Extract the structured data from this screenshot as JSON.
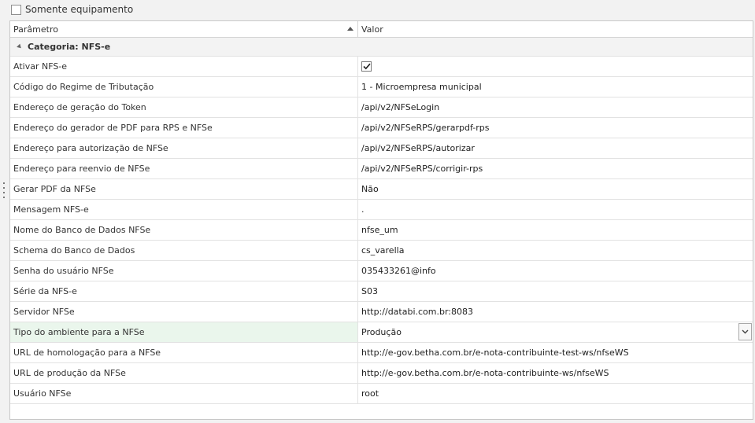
{
  "topbar": {
    "equipment_only_label": "Somente equipamento"
  },
  "grid": {
    "col_param": "Parâmetro",
    "col_value": "Valor",
    "category": "Categoria: NFS-e",
    "rows": [
      {
        "param": "Ativar NFS-e",
        "value": ""
      },
      {
        "param": "Código do Regime de Tributação",
        "value": "1 - Microempresa municipal"
      },
      {
        "param": "Endereço de geração do Token",
        "value": "/api/v2/NFSeLogin"
      },
      {
        "param": "Endereço do gerador de PDF para RPS e NFSe",
        "value": "/api/v2/NFSeRPS/gerarpdf-rps"
      },
      {
        "param": "Endereço para autorização de NFSe",
        "value": "/api/v2/NFSeRPS/autorizar"
      },
      {
        "param": "Endereço para reenvio de NFSe",
        "value": "/api/v2/NFSeRPS/corrigir-rps"
      },
      {
        "param": "Gerar PDF da NFSe",
        "value": "Não"
      },
      {
        "param": "Mensagem NFS-e",
        "value": "."
      },
      {
        "param": "Nome do Banco de Dados NFSe",
        "value": "nfse_um"
      },
      {
        "param": "Schema do Banco de Dados",
        "value": "cs_varella"
      },
      {
        "param": "Senha do usuário NFSe",
        "value": "035433261@info"
      },
      {
        "param": "Série da NFS-e",
        "value": "S03"
      },
      {
        "param": "Servidor NFSe",
        "value": "http://databi.com.br:8083"
      },
      {
        "param": "Tipo do ambiente para a NFSe",
        "value": "Produção"
      },
      {
        "param": "URL de homologação para a NFSe",
        "value": "http://e-gov.betha.com.br/e-nota-contribuinte-test-ws/nfseWS"
      },
      {
        "param": "URL de produção da NFSe",
        "value": "http://e-gov.betha.com.br/e-nota-contribuinte-ws/nfseWS"
      },
      {
        "param": "Usuário NFSe",
        "value": "root"
      }
    ]
  },
  "icons": {
    "checkmark": "check-icon",
    "combo": "chevron-down-icon",
    "sort": "sort-asc-icon",
    "expand": "collapse-triangle-icon"
  },
  "colors": {
    "selected_row": "#eaf6ec",
    "border": "#d4d4d4"
  }
}
